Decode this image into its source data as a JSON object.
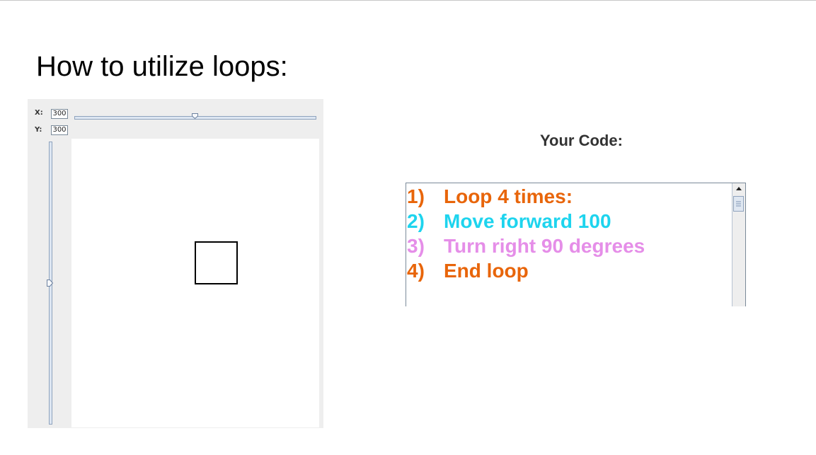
{
  "slide": {
    "title": "How to utilize loops:"
  },
  "turtle_panel": {
    "x_label": "X:",
    "x_value": "300",
    "y_label": "Y:",
    "y_value": "300",
    "x_slider_fraction": 0.5,
    "y_slider_fraction": 0.5
  },
  "code_panel": {
    "heading": "Your Code:",
    "lines": [
      {
        "num": "1)",
        "text": "Loop 4 times:",
        "color": "#e8650a"
      },
      {
        "num": "2)",
        "text": "Move forward 100",
        "color": "#1ed4ee"
      },
      {
        "num": "3)",
        "text": "Turn right 90 degrees",
        "color": "#e58ee8"
      },
      {
        "num": "4)",
        "text": "End loop",
        "color": "#e8650a"
      }
    ]
  },
  "colors": {
    "loop": "#e8650a",
    "move": "#1ed4ee",
    "turn": "#e58ee8",
    "panel_bg": "#eeeeee"
  }
}
